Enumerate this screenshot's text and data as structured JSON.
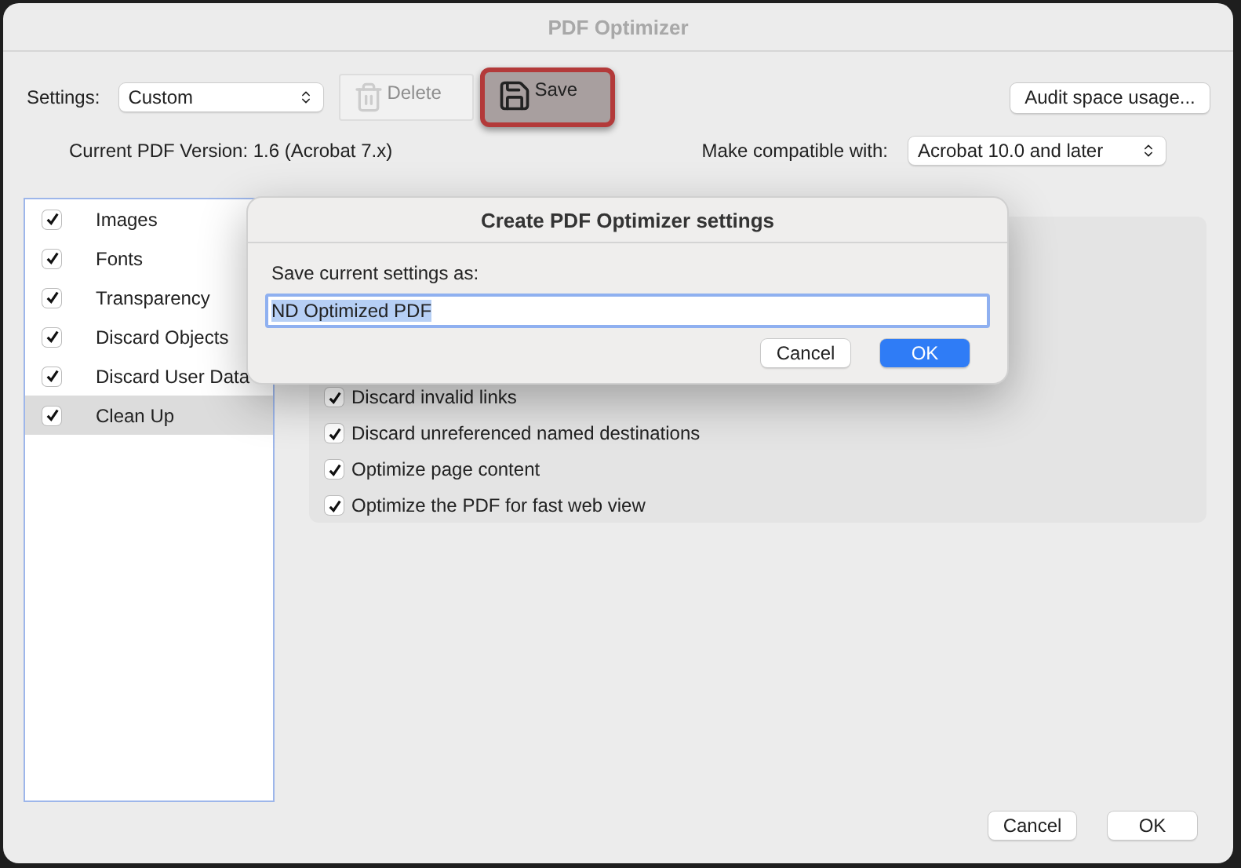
{
  "window": {
    "title": "PDF Optimizer"
  },
  "toolbar": {
    "settings_label": "Settings:",
    "settings_value": "Custom",
    "delete": {
      "label": "Delete",
      "disabled": true
    },
    "save": {
      "label": "Save",
      "highlighted": true
    },
    "audit": "Audit space usage..."
  },
  "version": "Current PDF Version: 1.6 (Acrobat 7.x)",
  "compat": {
    "label": "Make compatible with:",
    "value": "Acrobat 10.0 and later"
  },
  "panels": [
    {
      "label": "Images",
      "checked": true,
      "selected": false
    },
    {
      "label": "Fonts",
      "checked": true,
      "selected": false
    },
    {
      "label": "Transparency",
      "checked": true,
      "selected": false
    },
    {
      "label": "Discard Objects",
      "checked": true,
      "selected": false
    },
    {
      "label": "Discard User Data",
      "checked": true,
      "selected": false
    },
    {
      "label": "Clean Up",
      "checked": true,
      "selected": true
    }
  ],
  "options": [
    {
      "label": "Discard invalid links",
      "checked": true
    },
    {
      "label": "Discard unreferenced named destinations",
      "checked": true
    },
    {
      "label": "Optimize page content",
      "checked": true
    },
    {
      "label": "Optimize the PDF for fast web view",
      "checked": true
    }
  ],
  "dialog": {
    "title": "Create PDF Optimizer settings",
    "label": "Save current settings as:",
    "value": "ND Optimized PDF",
    "buttons": [
      {
        "label": "Cancel",
        "default": false
      },
      {
        "label": "OK",
        "default": true
      }
    ]
  },
  "buttons": [
    "Cancel",
    "OK"
  ]
}
